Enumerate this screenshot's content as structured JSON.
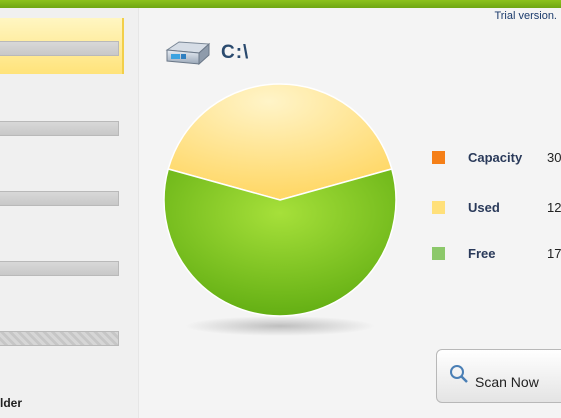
{
  "app": {
    "trial_text": "Trial version."
  },
  "sidebar": {
    "folder_label": "lder"
  },
  "drive": {
    "path": "C:\\",
    "icon": "hard-drive-icon"
  },
  "chart_data": {
    "type": "pie",
    "title": "",
    "slices": [
      {
        "label": "Used",
        "value": 12,
        "color": "#ffe48a"
      },
      {
        "label": "Free",
        "value": 17,
        "color": "#7fc61e"
      }
    ]
  },
  "legend": [
    {
      "label": "Capacity",
      "value": "30",
      "color": "#f57f17"
    },
    {
      "label": "Used",
      "value": "12",
      "color": "#ffe07a"
    },
    {
      "label": "Free",
      "value": "17",
      "color": "#8cc86a"
    }
  ],
  "scan_button": {
    "label": "Scan Now",
    "icon": "scan-icon"
  }
}
